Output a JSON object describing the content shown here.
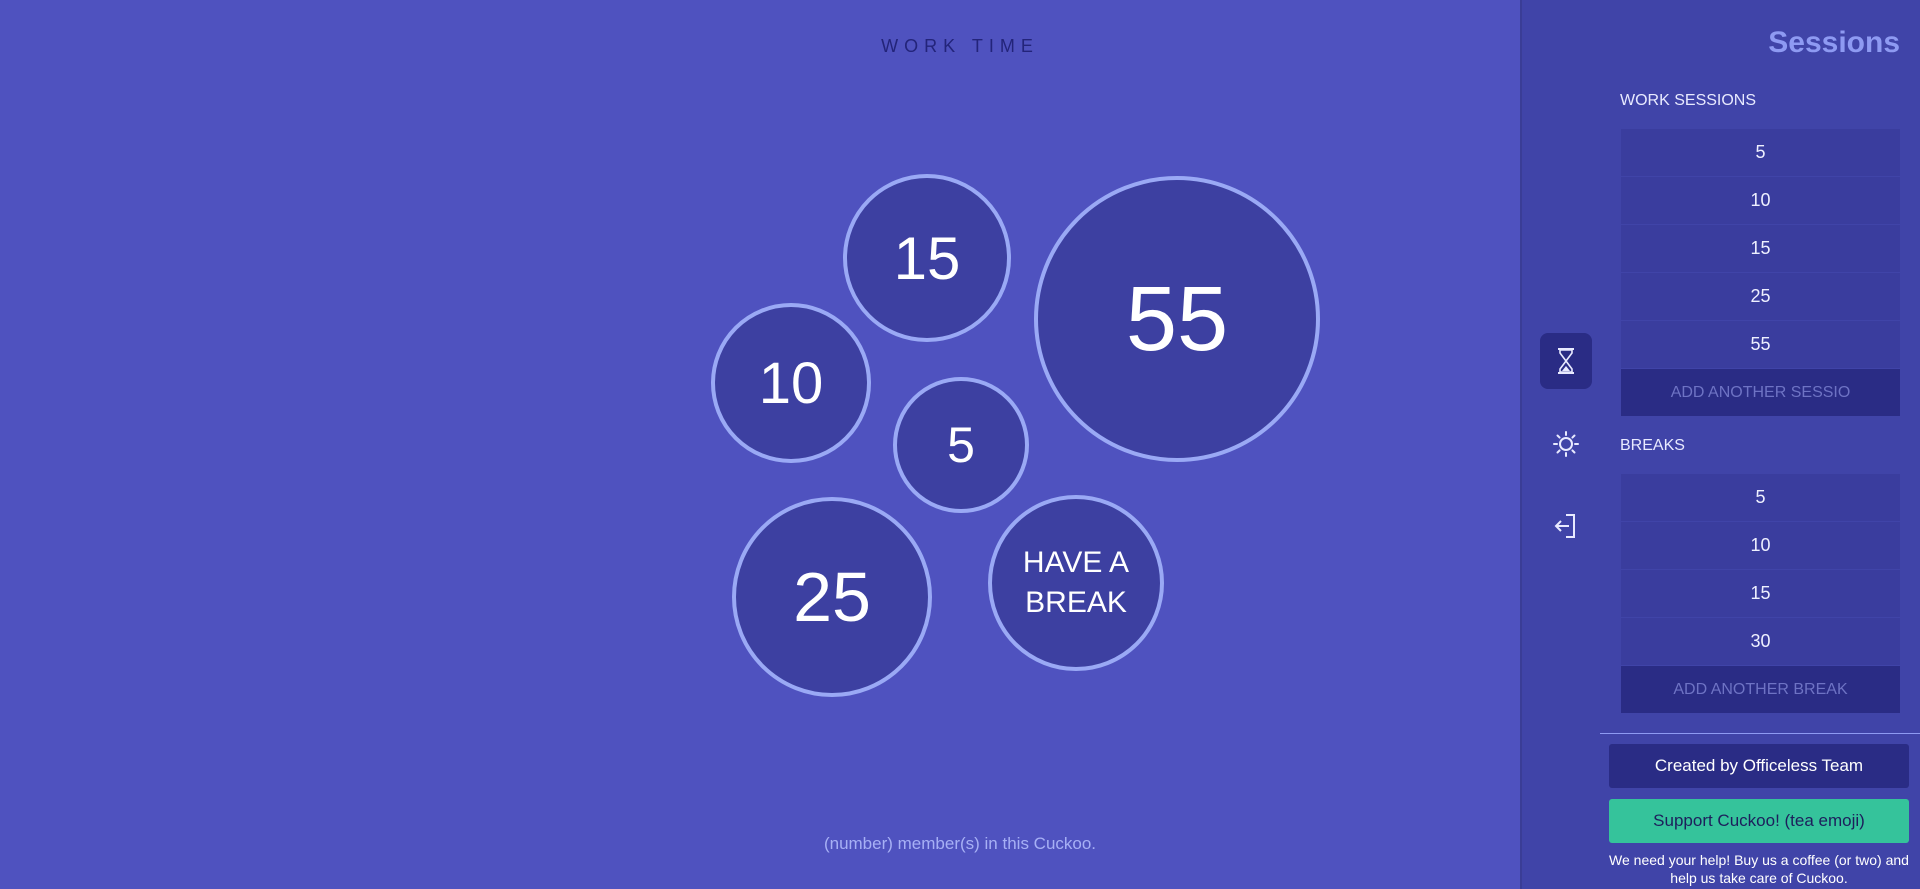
{
  "header": {
    "title": "WORK TIME"
  },
  "bubbles": {
    "b15": "15",
    "b55": "55",
    "b10": "10",
    "b5": "5",
    "b25": "25",
    "break": "HAVE A BREAK"
  },
  "footer": {
    "members": "(number) member(s) in this Cuckoo."
  },
  "sidebar": {
    "title": "Sessions",
    "icons": [
      "hourglass-icon",
      "sun-icon",
      "exit-icon"
    ],
    "work_label": "WORK SESSIONS",
    "work_sessions": [
      "5",
      "10",
      "15",
      "25",
      "55"
    ],
    "add_session": "ADD ANOTHER SESSIO",
    "breaks_label": "BREAKS",
    "breaks": [
      "5",
      "10",
      "15",
      "30"
    ],
    "add_break": "ADD ANOTHER BREAK",
    "credit": "Created by Officeless Team",
    "support": "Support Cuckoo! (tea emoji)",
    "help": "We need your help! Buy us a coffee (or two) and help us take care of Cuckoo."
  },
  "colors": {
    "background": "#4f52bf",
    "bubble_fill": "#3d40a1",
    "bubble_border": "#9aa9f5",
    "support_button": "#35c39b"
  }
}
